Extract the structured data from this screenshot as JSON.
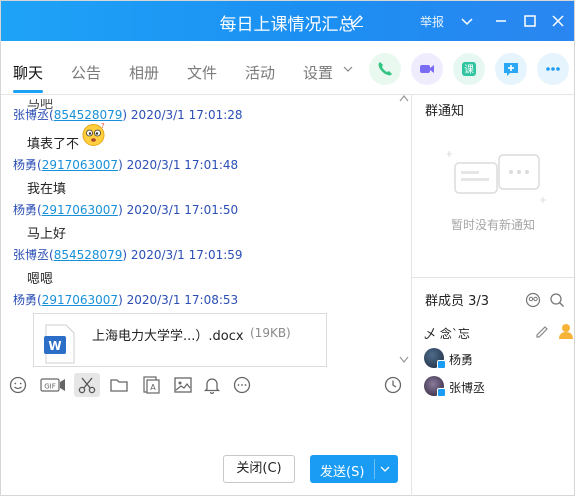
{
  "window": {
    "title": "每日上课情况汇总",
    "report_label": "举报"
  },
  "tabs": [
    {
      "label": "聊天",
      "active": true
    },
    {
      "label": "公告"
    },
    {
      "label": "相册"
    },
    {
      "label": "文件"
    },
    {
      "label": "活动"
    },
    {
      "label": "设置"
    }
  ],
  "action_buttons": [
    {
      "icon": "phone-icon",
      "color": "#3fcf8e"
    },
    {
      "icon": "video-icon",
      "color": "#7b6cf6"
    },
    {
      "icon": "lesson-icon",
      "color": "#2ec4a0"
    },
    {
      "icon": "screen-share-icon",
      "color": "#2aa8f5"
    },
    {
      "icon": "more-icon",
      "color": "#1e9cf5"
    }
  ],
  "messages": [
    {
      "sender": "张博丞",
      "qq": "854528079",
      "time": "2020/3/1 17:01:28",
      "text": "填表了不"
    },
    {
      "sender": "杨勇",
      "qq": "2917063007",
      "time": "2020/3/1 17:01:48",
      "text": "我在填"
    },
    {
      "sender": "杨勇",
      "qq": "2917063007",
      "time": "2020/3/1 17:01:50",
      "text": "马上好"
    },
    {
      "sender": "张博丞",
      "qq": "854528079",
      "time": "2020/3/1 17:01:59",
      "text": "嗯嗯"
    },
    {
      "sender": "杨勇",
      "qq": "2917063007",
      "time": "2020/3/1 17:08:53",
      "text": ""
    }
  ],
  "file": {
    "name": "上海电力大学学...）.docx",
    "size": "(19KB)"
  },
  "toolbar": [
    "emoji-icon",
    "gif-icon",
    "scissors-icon",
    "folder-icon",
    "image-text-icon",
    "image-icon",
    "bell-icon",
    "more-circle-icon",
    "history-clock-icon"
  ],
  "buttons": {
    "close": "关闭(C)",
    "send": "发送(S)"
  },
  "notice": {
    "title": "群通知",
    "empty": "暂时没有新通知"
  },
  "members": {
    "title": "群成员 3/3",
    "owner": "乄 念ˋ忘",
    "list": [
      {
        "name": "杨勇"
      },
      {
        "name": "张博丞"
      }
    ]
  },
  "colors": {
    "accent": "#1a9cf5",
    "link": "#2b4fb5"
  }
}
